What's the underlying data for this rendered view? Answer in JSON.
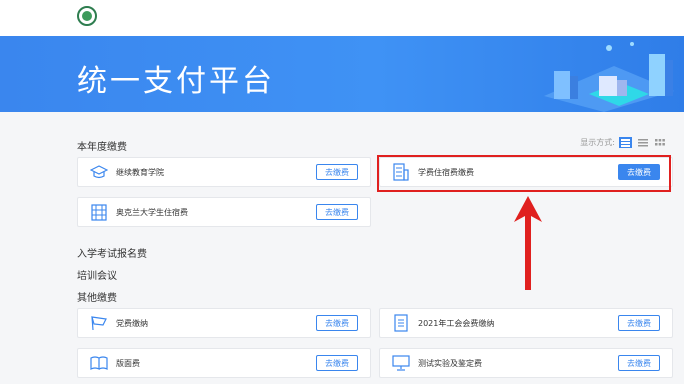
{
  "header": {
    "logo": "school-emblem-icon"
  },
  "banner": {
    "title": "统一支付平台"
  },
  "view_mode": {
    "label": "显示方式:"
  },
  "sections": {
    "current_year": "本年度缴费",
    "entrance": "入学考试报名费",
    "training": "培训会议",
    "other": "其他缴费"
  },
  "pay_label": "去缴费",
  "current_cards": [
    {
      "name": "继续教育学院",
      "icon": "graduation-cap-icon"
    },
    {
      "name": "学费住宿费缴费",
      "icon": "building-icon"
    },
    {
      "name": "奥克兰大学生住宿费",
      "icon": "apartment-icon"
    }
  ],
  "other_cards": [
    {
      "name": "党费缴纳",
      "icon": "flag-icon"
    },
    {
      "name": "2021年工会会费缴纳",
      "icon": "document-icon"
    },
    {
      "name": "版面费",
      "icon": "book-icon"
    },
    {
      "name": "测试实验及鉴定费",
      "icon": "monitor-icon"
    }
  ],
  "colors": {
    "accent": "#3a86ee",
    "highlight": "#e0201f"
  }
}
